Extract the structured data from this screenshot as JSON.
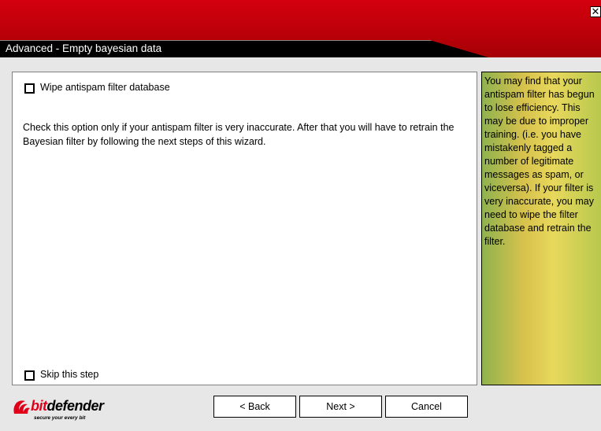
{
  "window": {
    "close_glyph": "✕"
  },
  "header": {
    "title": "Advanced - Empty bayesian data"
  },
  "main": {
    "wipe_option": {
      "label": "Wipe antispam filter database",
      "checked": false
    },
    "description": "Check this option only if your antispam filter is very inaccurate. After that you will have to retrain the Bayesian filter by following the next steps of this wizard.",
    "skip_option": {
      "label": "Skip this step",
      "checked": false
    }
  },
  "help": {
    "text": "You may find that your antispam filter has begun to lose efficiency. This may be due to improper training. (i.e. you have mistakenly tagged a number of legitimate messages as spam, or viceversa). If your filter is very inaccurate, you may need to wipe the filter database and retrain the filter."
  },
  "logo": {
    "bit": "bit",
    "defender": "defender",
    "tagline": "secure your every bit"
  },
  "buttons": {
    "back": "< Back",
    "next": "Next >",
    "cancel": "Cancel"
  },
  "colors": {
    "brand_red": "#c8000c",
    "title_bar": "#000000",
    "panel_bg": "#ffffff"
  }
}
